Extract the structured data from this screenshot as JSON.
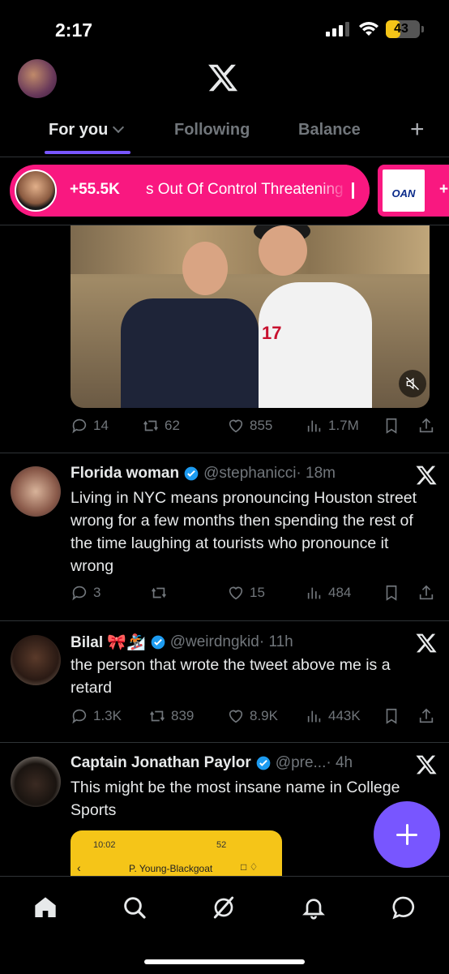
{
  "status_bar": {
    "time": "2:17",
    "battery": "43",
    "battery_level": 0.43
  },
  "tabs": [
    {
      "label": "For you",
      "active": true
    },
    {
      "label": "Following",
      "active": false
    },
    {
      "label": "Balance",
      "active": false
    }
  ],
  "trending": {
    "count": "+55.5K",
    "text": "s Out Of Control Threatening",
    "second_logo": "OAN",
    "second_count": "+"
  },
  "tweets": [
    {
      "stats": {
        "replies": "14",
        "reposts": "62",
        "likes": "855",
        "views": "1.7M"
      }
    },
    {
      "name": "Florida woman",
      "handle": "@stephanicci",
      "time": "· 18m",
      "text": "Living in NYC means pronouncing Houston street wrong for a few months then spending the rest of the time laughing at tourists who pronounce it wrong",
      "stats": {
        "replies": "3",
        "reposts": "",
        "likes": "15",
        "views": "484"
      }
    },
    {
      "name": "Bilal 🎀🏂",
      "handle": "@weirdngkid",
      "time": "· 11h",
      "text": "the person that wrote the tweet above me is a retard",
      "stats": {
        "replies": "1.3K",
        "reposts": "839",
        "likes": "8.9K",
        "views": "443K"
      }
    },
    {
      "name": "Captain Jonathan Paylor",
      "handle": "@pre...",
      "time": "· 4h",
      "text": "This might be the most insane name in College Sports",
      "embed": {
        "time": "10:02",
        "title": "P. Young-Blackgoat",
        "status": "52"
      }
    }
  ],
  "media": {
    "jersey_number": "17"
  },
  "colors": {
    "accent": "#7856ff",
    "trend": "#f91880",
    "verified": "#1d9bf0",
    "muted": "#71767b"
  },
  "icons": [
    "home-icon",
    "search-icon",
    "grok-icon",
    "notifications-icon",
    "messages-icon"
  ]
}
